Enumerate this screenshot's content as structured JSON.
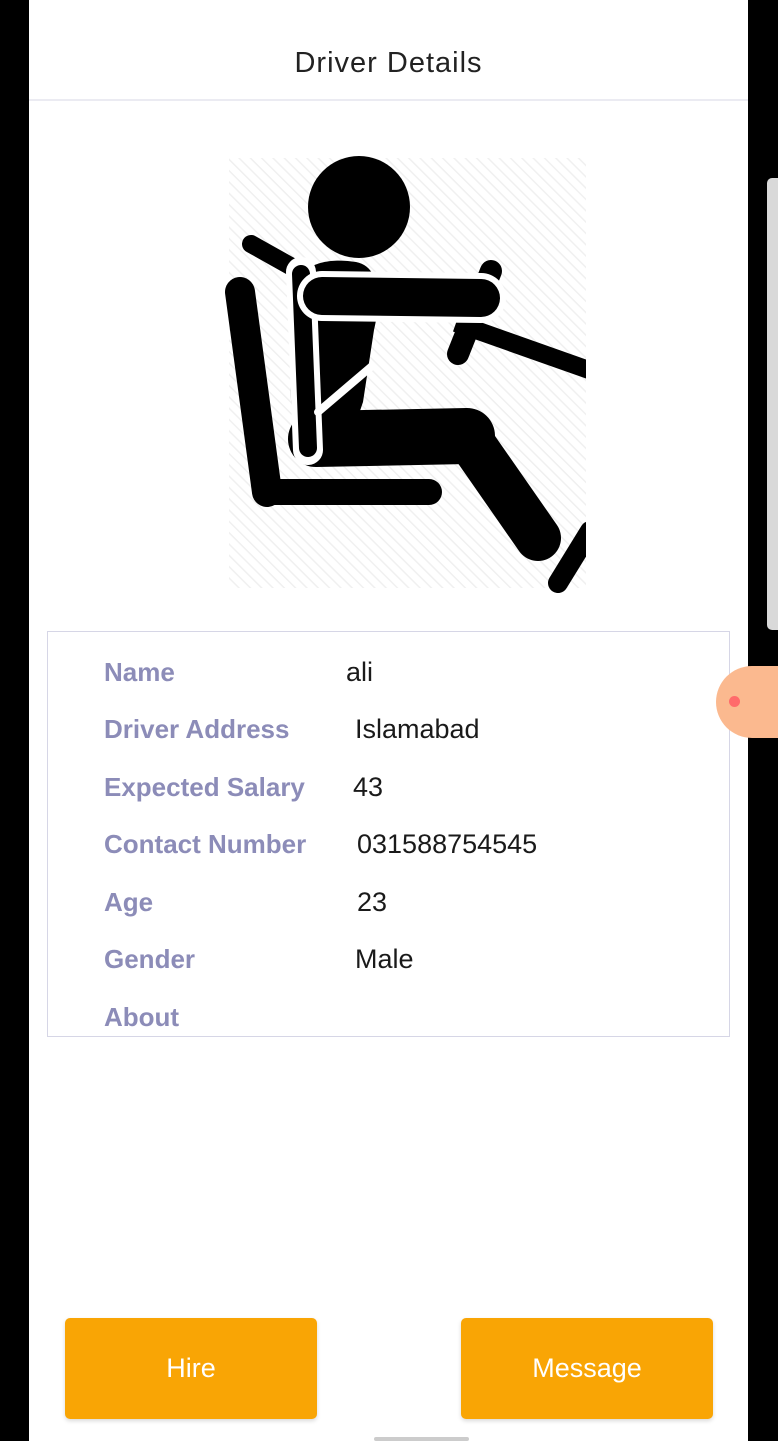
{
  "header": {
    "title": "Driver Details"
  },
  "avatar": {
    "icon": "car-driver-seatbelt-icon"
  },
  "details": [
    {
      "label": "Name",
      "value": "ali"
    },
    {
      "label": "Driver Address",
      "value": "Islamabad"
    },
    {
      "label": "Expected Salary",
      "value": "43"
    },
    {
      "label": "Contact Number",
      "value": "031588754545"
    },
    {
      "label": "Age",
      "value": "23"
    },
    {
      "label": "Gender",
      "value": "Male"
    },
    {
      "label": "About",
      "value": ""
    }
  ],
  "actions": {
    "hire_label": "Hire",
    "message_label": "Message"
  },
  "colors": {
    "accent": "#f9a505",
    "label": "#8c8cb8",
    "divider": "#ebebf2",
    "card_border": "#d6d6e6"
  }
}
